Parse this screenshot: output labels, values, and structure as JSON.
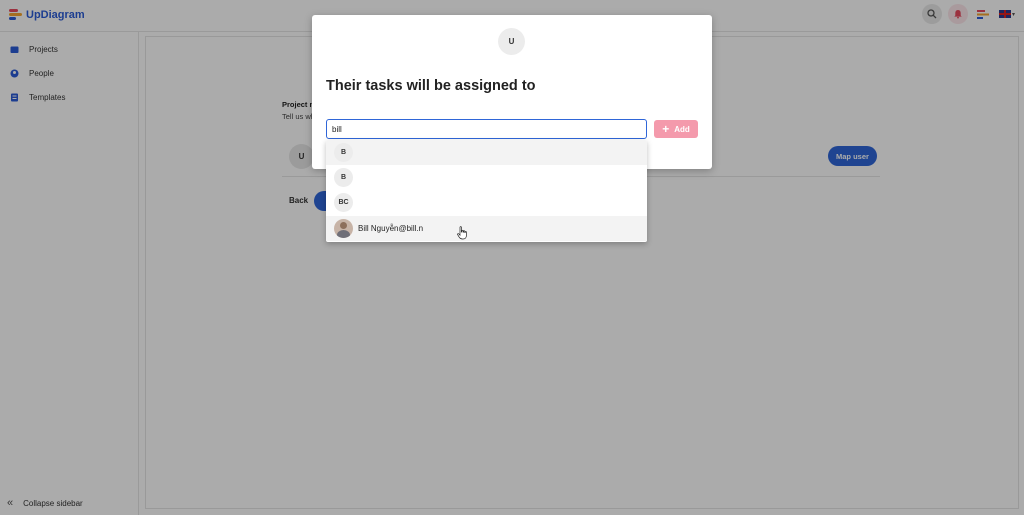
{
  "app": {
    "name": "UpDiagram",
    "logo_colors": [
      "#e84a5f",
      "#f7a531",
      "#2a5bd7"
    ]
  },
  "topbar": {
    "icons": [
      "search-icon",
      "bell-icon",
      "menu-bars-icon",
      "uk-flag-icon"
    ],
    "language_caret": "▾"
  },
  "sidebar": {
    "items": [
      {
        "label": "Projects",
        "icon": "folder-icon"
      },
      {
        "label": "People",
        "icon": "person-icon"
      },
      {
        "label": "Templates",
        "icon": "templates-icon"
      }
    ],
    "collapse_label": "Collapse sidebar",
    "collapse_glyph": "«"
  },
  "page": {
    "section_title": "Project m",
    "section_subtitle": "Tell us wh",
    "row_avatar": "U",
    "map_user_label": "Map user",
    "back_label": "Back"
  },
  "modal": {
    "avatar_initial": "U",
    "title": "Their tasks will be assigned to",
    "search_value": "bill",
    "add_plus": "+",
    "add_label": "Add",
    "add_color": "#f49aac",
    "accent_color": "#2f66d8"
  },
  "dropdown": {
    "options": [
      {
        "initials": "B",
        "label": "",
        "highlighted": true
      },
      {
        "initials": "B",
        "label": "",
        "highlighted": false
      },
      {
        "initials": "BC",
        "label": "",
        "highlighted": false
      },
      {
        "initials": "",
        "label": "Bill Nguyễn@bill.n",
        "highlighted": true,
        "has_photo": true
      }
    ]
  }
}
